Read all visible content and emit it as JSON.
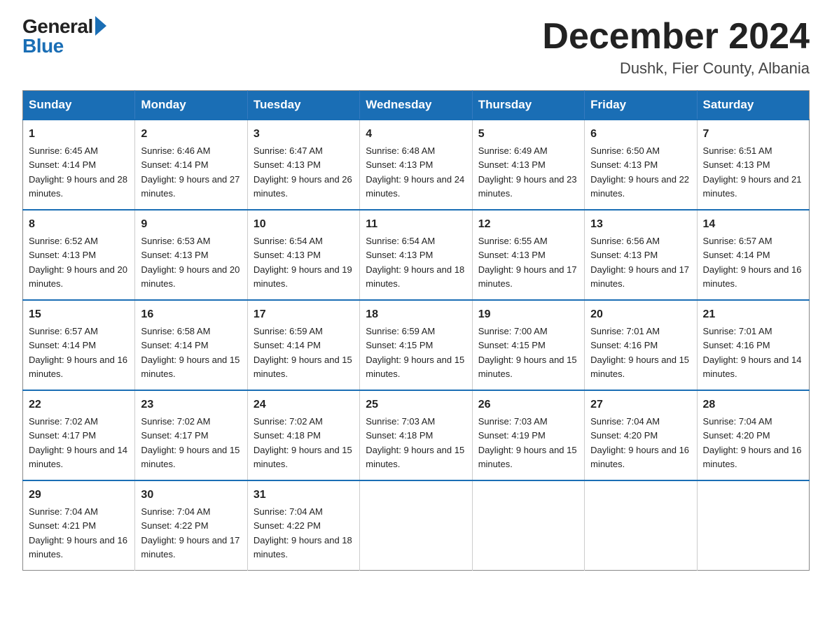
{
  "header": {
    "logo_general": "General",
    "logo_blue": "Blue",
    "month_title": "December 2024",
    "location": "Dushk, Fier County, Albania"
  },
  "calendar": {
    "days_of_week": [
      "Sunday",
      "Monday",
      "Tuesday",
      "Wednesday",
      "Thursday",
      "Friday",
      "Saturday"
    ],
    "weeks": [
      [
        {
          "day": "1",
          "sunrise": "Sunrise: 6:45 AM",
          "sunset": "Sunset: 4:14 PM",
          "daylight": "Daylight: 9 hours and 28 minutes."
        },
        {
          "day": "2",
          "sunrise": "Sunrise: 6:46 AM",
          "sunset": "Sunset: 4:14 PM",
          "daylight": "Daylight: 9 hours and 27 minutes."
        },
        {
          "day": "3",
          "sunrise": "Sunrise: 6:47 AM",
          "sunset": "Sunset: 4:13 PM",
          "daylight": "Daylight: 9 hours and 26 minutes."
        },
        {
          "day": "4",
          "sunrise": "Sunrise: 6:48 AM",
          "sunset": "Sunset: 4:13 PM",
          "daylight": "Daylight: 9 hours and 24 minutes."
        },
        {
          "day": "5",
          "sunrise": "Sunrise: 6:49 AM",
          "sunset": "Sunset: 4:13 PM",
          "daylight": "Daylight: 9 hours and 23 minutes."
        },
        {
          "day": "6",
          "sunrise": "Sunrise: 6:50 AM",
          "sunset": "Sunset: 4:13 PM",
          "daylight": "Daylight: 9 hours and 22 minutes."
        },
        {
          "day": "7",
          "sunrise": "Sunrise: 6:51 AM",
          "sunset": "Sunset: 4:13 PM",
          "daylight": "Daylight: 9 hours and 21 minutes."
        }
      ],
      [
        {
          "day": "8",
          "sunrise": "Sunrise: 6:52 AM",
          "sunset": "Sunset: 4:13 PM",
          "daylight": "Daylight: 9 hours and 20 minutes."
        },
        {
          "day": "9",
          "sunrise": "Sunrise: 6:53 AM",
          "sunset": "Sunset: 4:13 PM",
          "daylight": "Daylight: 9 hours and 20 minutes."
        },
        {
          "day": "10",
          "sunrise": "Sunrise: 6:54 AM",
          "sunset": "Sunset: 4:13 PM",
          "daylight": "Daylight: 9 hours and 19 minutes."
        },
        {
          "day": "11",
          "sunrise": "Sunrise: 6:54 AM",
          "sunset": "Sunset: 4:13 PM",
          "daylight": "Daylight: 9 hours and 18 minutes."
        },
        {
          "day": "12",
          "sunrise": "Sunrise: 6:55 AM",
          "sunset": "Sunset: 4:13 PM",
          "daylight": "Daylight: 9 hours and 17 minutes."
        },
        {
          "day": "13",
          "sunrise": "Sunrise: 6:56 AM",
          "sunset": "Sunset: 4:13 PM",
          "daylight": "Daylight: 9 hours and 17 minutes."
        },
        {
          "day": "14",
          "sunrise": "Sunrise: 6:57 AM",
          "sunset": "Sunset: 4:14 PM",
          "daylight": "Daylight: 9 hours and 16 minutes."
        }
      ],
      [
        {
          "day": "15",
          "sunrise": "Sunrise: 6:57 AM",
          "sunset": "Sunset: 4:14 PM",
          "daylight": "Daylight: 9 hours and 16 minutes."
        },
        {
          "day": "16",
          "sunrise": "Sunrise: 6:58 AM",
          "sunset": "Sunset: 4:14 PM",
          "daylight": "Daylight: 9 hours and 15 minutes."
        },
        {
          "day": "17",
          "sunrise": "Sunrise: 6:59 AM",
          "sunset": "Sunset: 4:14 PM",
          "daylight": "Daylight: 9 hours and 15 minutes."
        },
        {
          "day": "18",
          "sunrise": "Sunrise: 6:59 AM",
          "sunset": "Sunset: 4:15 PM",
          "daylight": "Daylight: 9 hours and 15 minutes."
        },
        {
          "day": "19",
          "sunrise": "Sunrise: 7:00 AM",
          "sunset": "Sunset: 4:15 PM",
          "daylight": "Daylight: 9 hours and 15 minutes."
        },
        {
          "day": "20",
          "sunrise": "Sunrise: 7:01 AM",
          "sunset": "Sunset: 4:16 PM",
          "daylight": "Daylight: 9 hours and 15 minutes."
        },
        {
          "day": "21",
          "sunrise": "Sunrise: 7:01 AM",
          "sunset": "Sunset: 4:16 PM",
          "daylight": "Daylight: 9 hours and 14 minutes."
        }
      ],
      [
        {
          "day": "22",
          "sunrise": "Sunrise: 7:02 AM",
          "sunset": "Sunset: 4:17 PM",
          "daylight": "Daylight: 9 hours and 14 minutes."
        },
        {
          "day": "23",
          "sunrise": "Sunrise: 7:02 AM",
          "sunset": "Sunset: 4:17 PM",
          "daylight": "Daylight: 9 hours and 15 minutes."
        },
        {
          "day": "24",
          "sunrise": "Sunrise: 7:02 AM",
          "sunset": "Sunset: 4:18 PM",
          "daylight": "Daylight: 9 hours and 15 minutes."
        },
        {
          "day": "25",
          "sunrise": "Sunrise: 7:03 AM",
          "sunset": "Sunset: 4:18 PM",
          "daylight": "Daylight: 9 hours and 15 minutes."
        },
        {
          "day": "26",
          "sunrise": "Sunrise: 7:03 AM",
          "sunset": "Sunset: 4:19 PM",
          "daylight": "Daylight: 9 hours and 15 minutes."
        },
        {
          "day": "27",
          "sunrise": "Sunrise: 7:04 AM",
          "sunset": "Sunset: 4:20 PM",
          "daylight": "Daylight: 9 hours and 16 minutes."
        },
        {
          "day": "28",
          "sunrise": "Sunrise: 7:04 AM",
          "sunset": "Sunset: 4:20 PM",
          "daylight": "Daylight: 9 hours and 16 minutes."
        }
      ],
      [
        {
          "day": "29",
          "sunrise": "Sunrise: 7:04 AM",
          "sunset": "Sunset: 4:21 PM",
          "daylight": "Daylight: 9 hours and 16 minutes."
        },
        {
          "day": "30",
          "sunrise": "Sunrise: 7:04 AM",
          "sunset": "Sunset: 4:22 PM",
          "daylight": "Daylight: 9 hours and 17 minutes."
        },
        {
          "day": "31",
          "sunrise": "Sunrise: 7:04 AM",
          "sunset": "Sunset: 4:22 PM",
          "daylight": "Daylight: 9 hours and 18 minutes."
        },
        null,
        null,
        null,
        null
      ]
    ]
  }
}
